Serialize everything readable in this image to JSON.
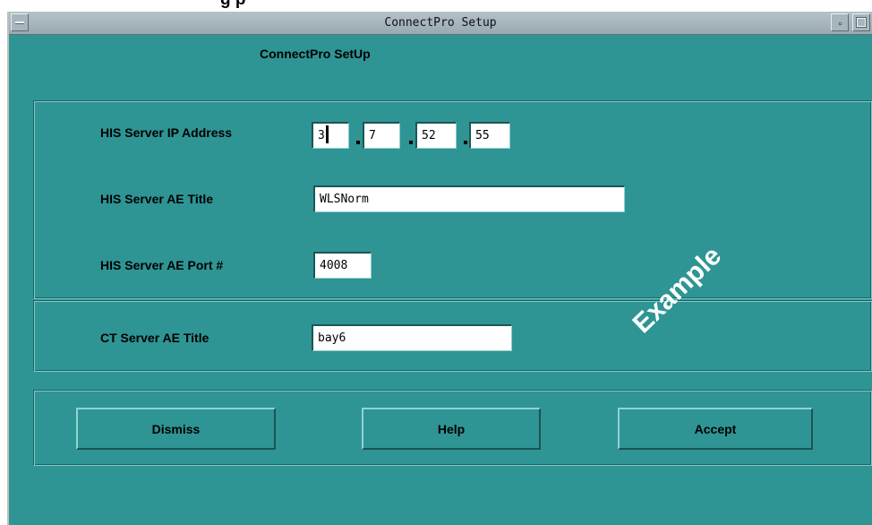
{
  "document": {
    "heading_partial": "g                                                         p"
  },
  "window": {
    "title": "ConnectPro Setup",
    "controls": {
      "menu_icon": "window-menu-icon",
      "minimize_icon": "minimize-icon",
      "maximize_icon": "maximize-icon"
    }
  },
  "dialog": {
    "title": "ConnectPro SetUp",
    "his_ip": {
      "label": "HIS Server IP Address",
      "octets": [
        "3",
        "7",
        "52",
        "55"
      ],
      "separator": "."
    },
    "his_ae_title": {
      "label": "HIS Server AE Title",
      "value": "WLSNorm"
    },
    "his_ae_port": {
      "label": "HIS Server AE Port #",
      "value": "4008"
    },
    "ct_ae_title": {
      "label": "CT Server AE Title",
      "value": "bay6"
    },
    "buttons": {
      "dismiss": "Dismiss",
      "help": "Help",
      "accept": "Accept"
    },
    "watermark": "Example"
  },
  "colors": {
    "window_bg": "#2f9494",
    "titlebar": "#a7b6bc",
    "field_bg": "#ffffff",
    "watermark": "#ffffff"
  }
}
